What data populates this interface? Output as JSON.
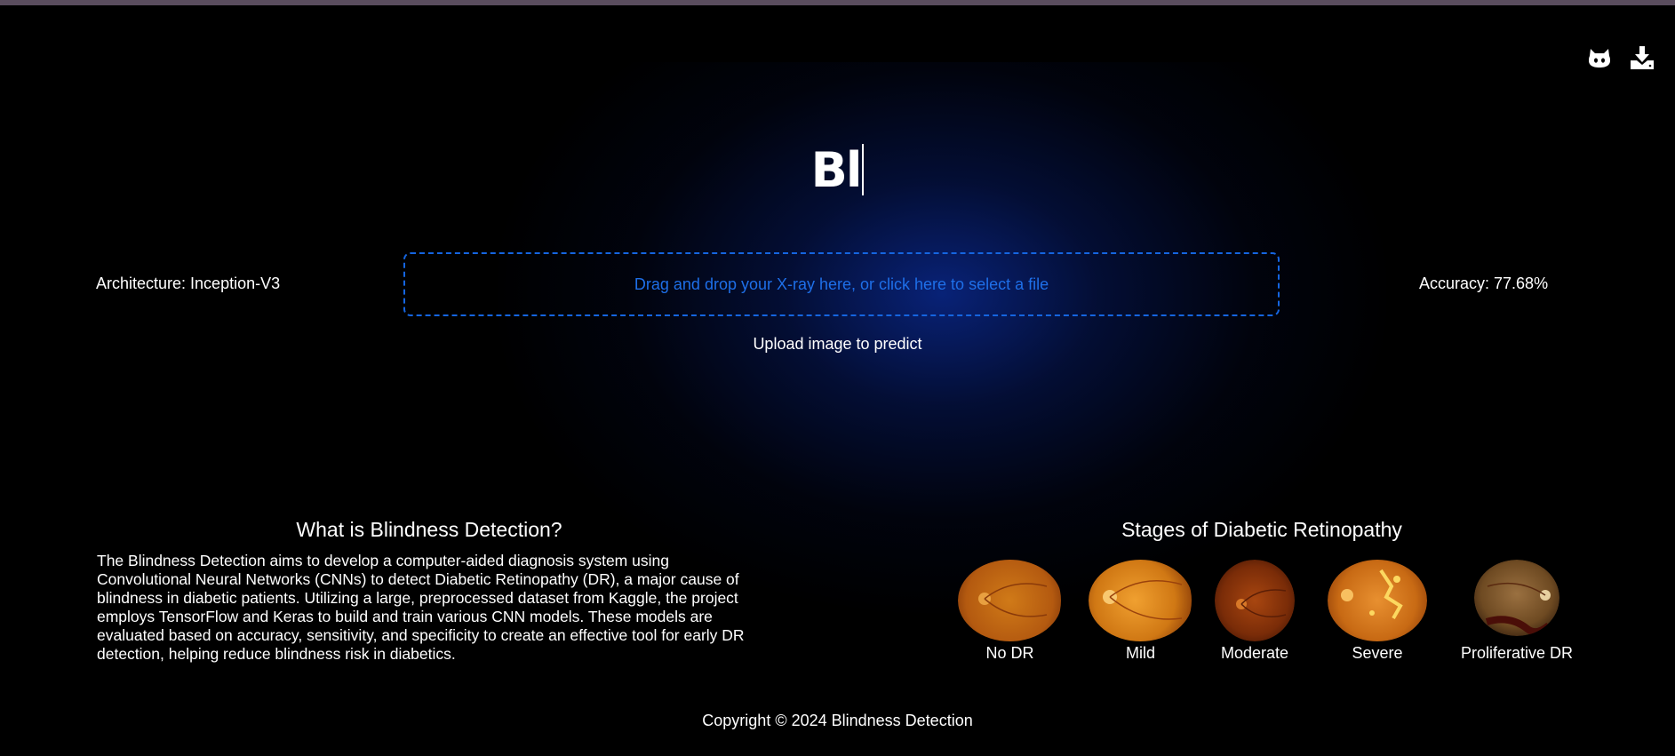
{
  "header": {
    "title_typed": "Bl",
    "icons": [
      "github-icon",
      "download-icon"
    ]
  },
  "model": {
    "architecture_label": "Architecture: Inception-V3",
    "accuracy_label": "Accuracy: 77.68%"
  },
  "upload": {
    "dropzone_text": "Drag and drop your X-ray here, or click here to select a file",
    "status_text": "Upload image to predict"
  },
  "about": {
    "title": "What is Blindness Detection?",
    "text": "The Blindness Detection aims to develop a computer-aided diagnosis system using Convolutional Neural Networks (CNNs) to detect Diabetic Retinopathy (DR), a major cause of blindness in diabetic patients. Utilizing a large, preprocessed dataset from Kaggle, the project employs TensorFlow and Keras to build and train various CNN models. These models are evaluated based on accuracy, sensitivity, and specificity to create an effective tool for early DR detection, helping reduce blindness risk in diabetics."
  },
  "stages": {
    "title": "Stages of Diabetic Retinopathy",
    "items": [
      {
        "label": "No DR"
      },
      {
        "label": "Mild"
      },
      {
        "label": "Moderate"
      },
      {
        "label": "Severe"
      },
      {
        "label": "Proliferative DR"
      }
    ]
  },
  "footer": {
    "copyright": "Copyright © 2024 Blindness Detection"
  },
  "colors": {
    "accent": "#1565e0",
    "background": "#000000",
    "glow": "#0a288c"
  }
}
